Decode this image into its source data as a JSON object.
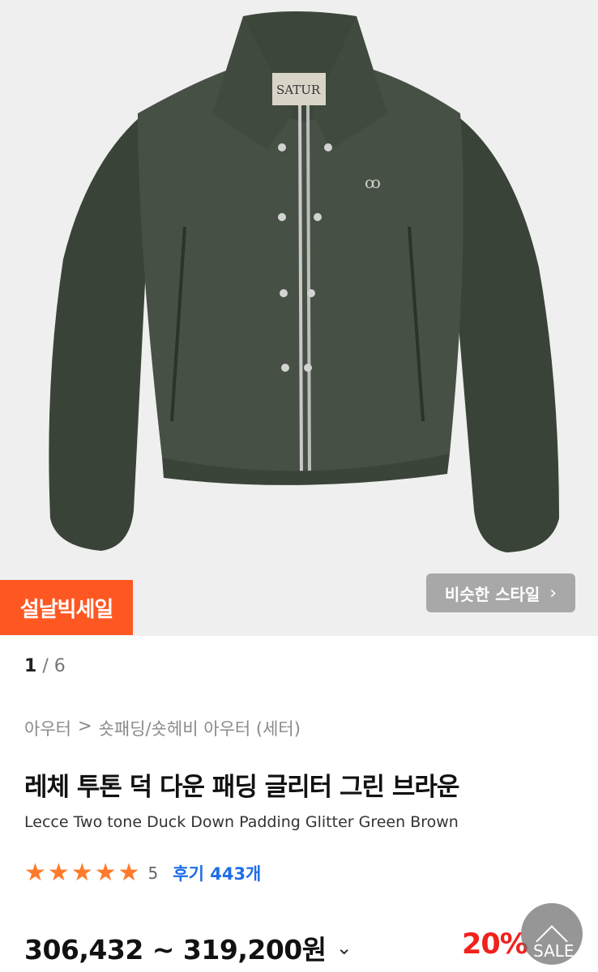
{
  "product_image": {
    "badge": "설날빅세일",
    "similar_button": {
      "label": "비슷한 스타일",
      "icon": "chevron-right-icon"
    },
    "label_text": "SATUR"
  },
  "pagination": {
    "current": "1",
    "separator": "/",
    "total": "6"
  },
  "breadcrumb": {
    "category": "아우터",
    "separator": ">",
    "subcategory": "숏패딩/숏헤비 아우터 (세터)"
  },
  "product": {
    "title_ko": "레체 투톤 덕 다운 패딩 글리터 그린 브라운",
    "title_en": "Lecce Two tone Duck Down Padding Glitter Green Brown"
  },
  "rating": {
    "stars": 5,
    "score": "5",
    "reviews_label": "후기 443개",
    "star_color": "#ff7a2b"
  },
  "price": {
    "range": "306,432 ~ 319,200원",
    "discount": "20%",
    "discount_color": "#f0221c"
  },
  "scroll_top": {
    "label": "SALE",
    "icon": "arrow-up-icon"
  },
  "colors": {
    "accent": "#ff5722",
    "link": "#1e6ee8"
  }
}
